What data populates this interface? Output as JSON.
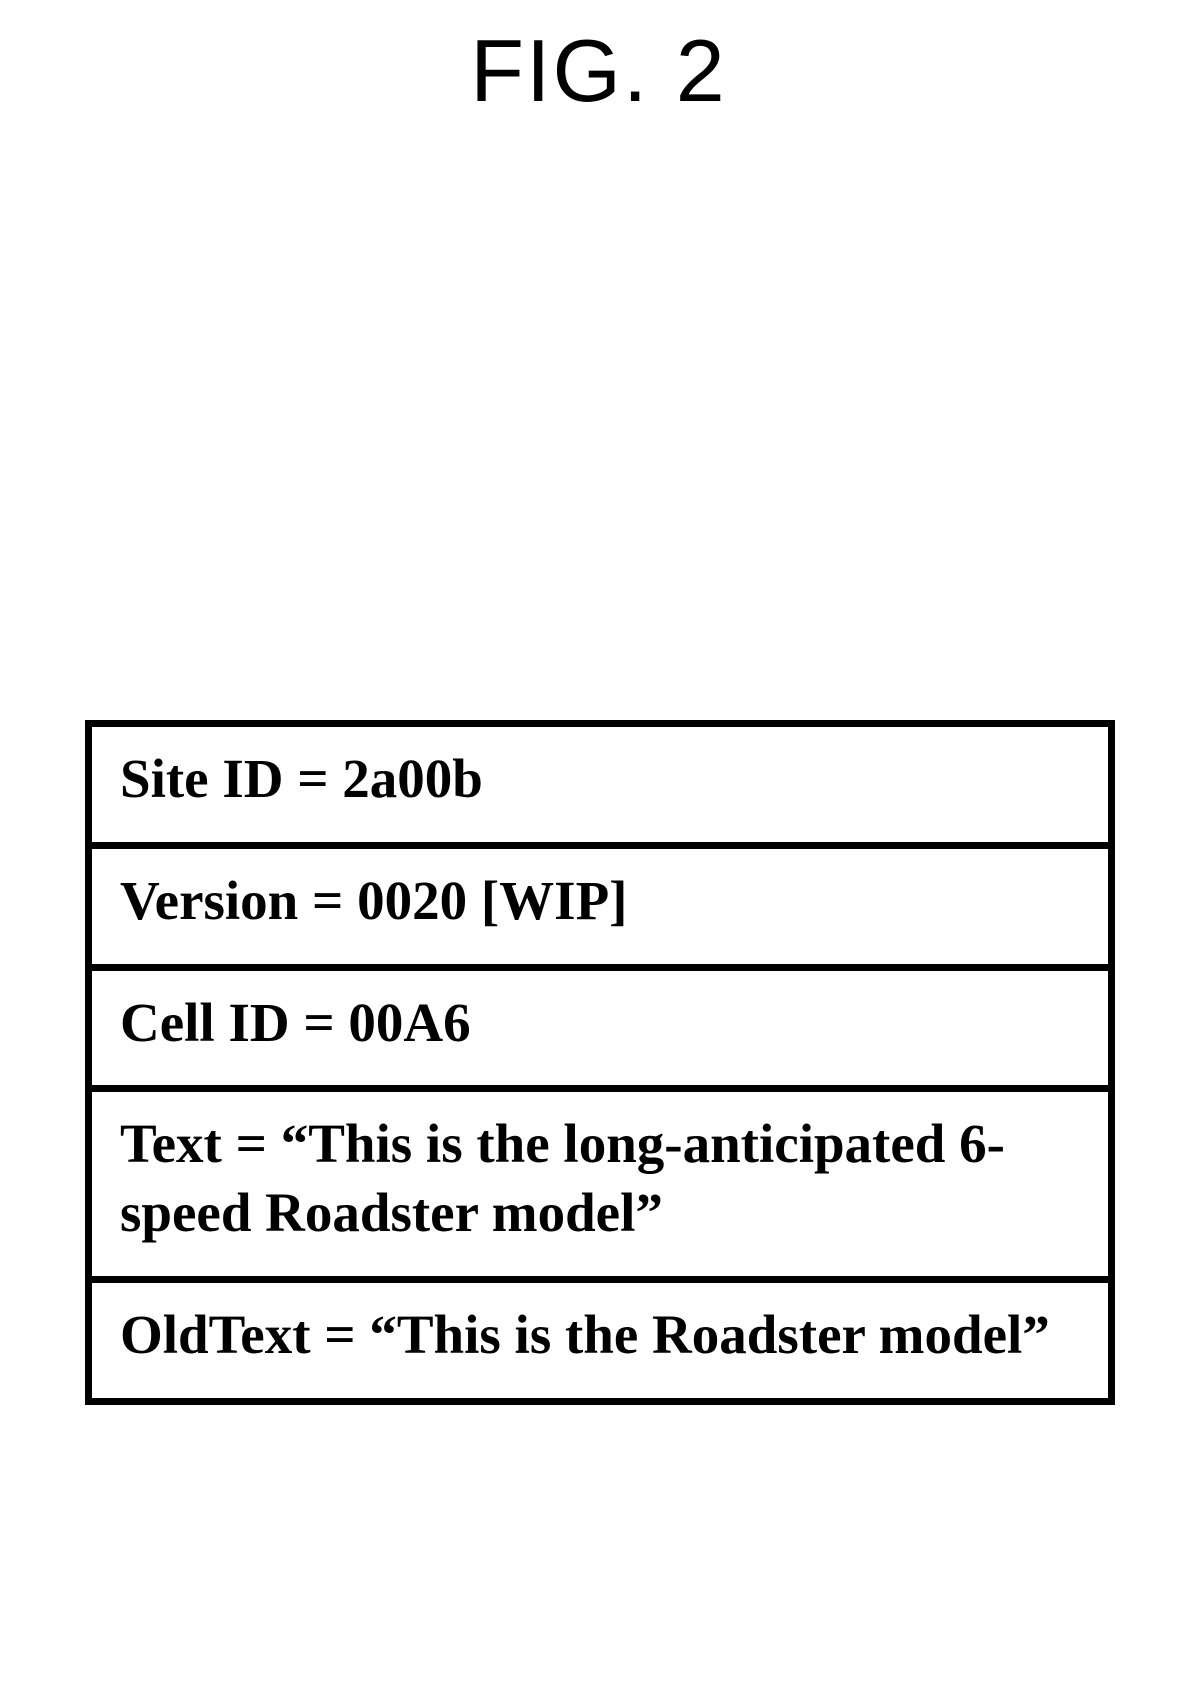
{
  "figure": {
    "title": "FIG. 2"
  },
  "rows": [
    {
      "text": "Site ID = 2a00b"
    },
    {
      "text": "Version = 0020 [WIP]"
    },
    {
      "text": "Cell ID = 00A6"
    },
    {
      "text": "Text = “This is the long-anticipated 6-speed Roadster model”"
    },
    {
      "text": "OldText = “This is the Roadster model”"
    }
  ]
}
